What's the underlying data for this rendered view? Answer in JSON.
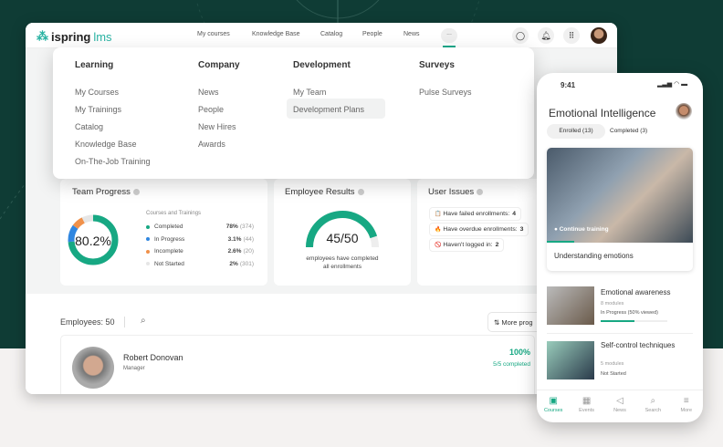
{
  "app": {
    "logo": "ispring",
    "logo_suffix": "lms"
  },
  "nav": {
    "items": [
      "My courses",
      "Knowledge Base",
      "Catalog",
      "People",
      "News"
    ],
    "more": "..."
  },
  "menu": {
    "columns": [
      {
        "title": "Learning",
        "items": [
          "My Courses",
          "My Trainings",
          "Catalog",
          "Knowledge Base",
          "On-The-Job Training"
        ]
      },
      {
        "title": "Company",
        "items": [
          "News",
          "People",
          "New Hires",
          "Awards"
        ]
      },
      {
        "title": "Development",
        "items": [
          "My Team",
          "Development Plans"
        ]
      },
      {
        "title": "Surveys",
        "items": [
          "Pulse Surveys"
        ]
      }
    ]
  },
  "team_progress": {
    "title": "Team Progress",
    "center": "80.2%",
    "legend_title": "Courses and Trainings",
    "items": [
      {
        "label": "Completed",
        "pct": "78%",
        "count": "(374)",
        "value": 78,
        "color": "#17a883"
      },
      {
        "label": "In Progress",
        "pct": "3.1%",
        "count": "(44)",
        "value": 12,
        "color": "#2f86e0"
      },
      {
        "label": "Incomplete",
        "pct": "2.6%",
        "count": "(20)",
        "value": 8,
        "color": "#f0914a"
      },
      {
        "label": "Not Started",
        "pct": "2%",
        "count": "(301)",
        "value": 8,
        "color": "#e6e6e6"
      }
    ]
  },
  "employee_results": {
    "title": "Employee Results",
    "value": "45/50",
    "fraction": 0.9,
    "caption1": "employees have completed",
    "caption2": "all enrollments"
  },
  "user_issues": {
    "title": "User Issues",
    "items": [
      {
        "label": "Have failed enrollments:",
        "count": "4",
        "icon": "📋"
      },
      {
        "label": "Have overdue enrollments:",
        "count": "3",
        "icon": "🔥"
      },
      {
        "label": "Haven't logged in:",
        "count": "2",
        "icon": "🚫"
      }
    ]
  },
  "employees": {
    "label": "Employees:",
    "count": "50",
    "sort_button": "More prog",
    "row": {
      "name": "Robert Donovan",
      "role": "Manager",
      "pct": "100%",
      "completed": "5/5 completed"
    }
  },
  "phone": {
    "time": "9:41",
    "title": "Emotional Intelligence",
    "tabs": [
      "Enrolled (13)",
      "Completed (3)"
    ],
    "featured": {
      "cta": "Continue training",
      "title": "Understanding emotions"
    },
    "courses": [
      {
        "title": "Emotional awareness",
        "modules": "8 modules",
        "status": "In Progress (50% viewed)",
        "progress": 0.5
      },
      {
        "title": "Self-control techniques",
        "modules": "5 modules",
        "status": "Not Started"
      }
    ],
    "tabbar": [
      "Courses",
      "Events",
      "News",
      "Search",
      "More"
    ]
  },
  "colors": {
    "accent": "#17a883",
    "bg_dark": "#0f3c35"
  }
}
